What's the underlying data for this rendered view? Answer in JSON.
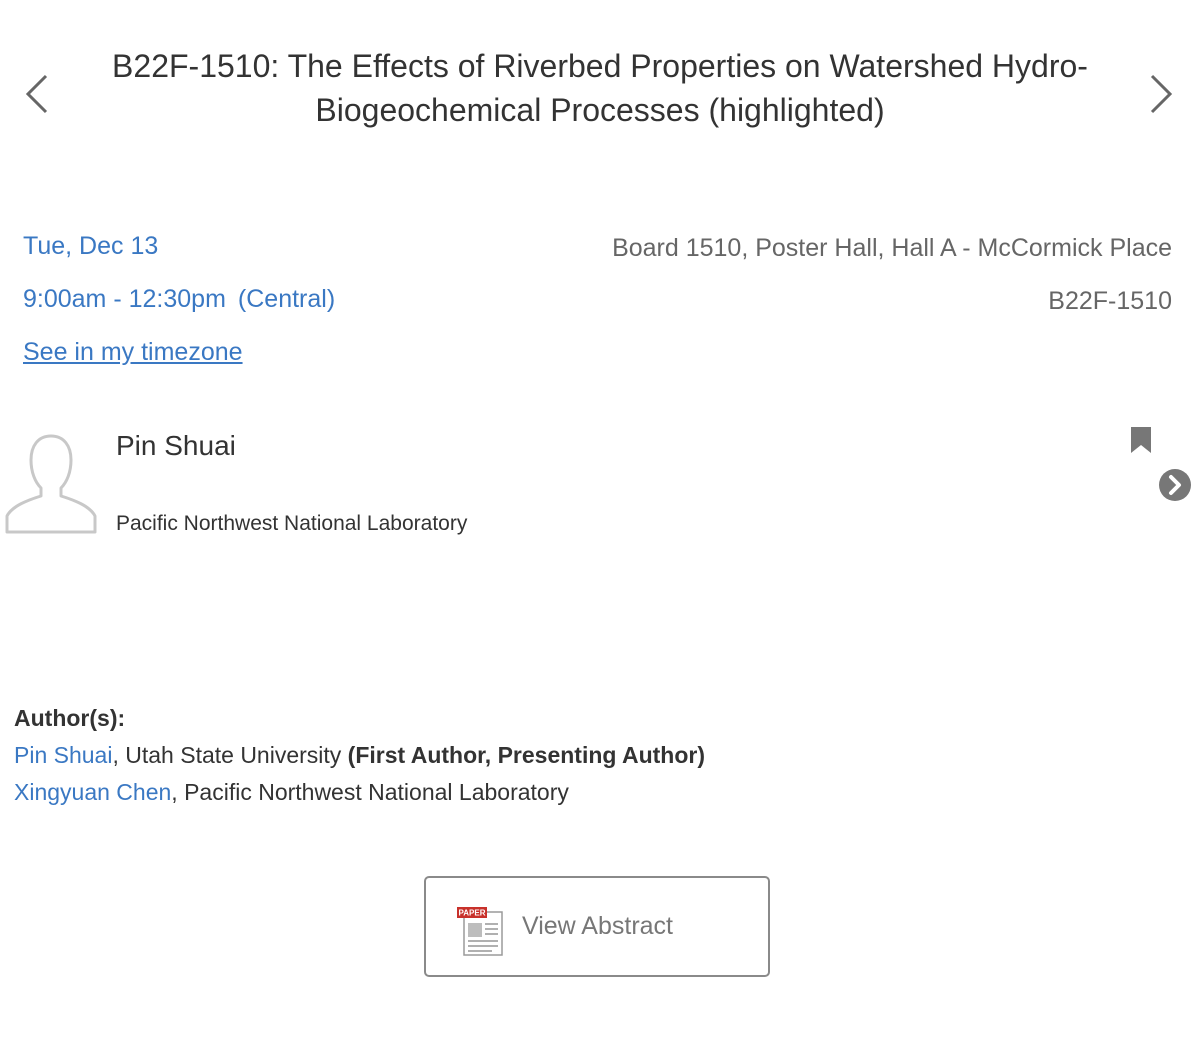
{
  "navigation": {
    "prev_icon": "chevron-left-icon",
    "next_icon": "chevron-right-icon"
  },
  "session": {
    "title": "B22F-1510: The Effects of Riverbed Properties on Watershed Hydro-Biogeochemical Processes (highlighted)",
    "date": "Tue, Dec 13",
    "time": "9:00am - 12:30pm",
    "timezone": "(Central)",
    "timezone_link": "See in my timezone",
    "location": "Board 1510, Poster Hall, Hall A - McCormick Place",
    "code": "B22F-1510"
  },
  "presenter": {
    "name": "Pin Shuai",
    "institution": "Pacific Northwest National Laboratory",
    "avatar_icon": "person-silhouette-icon",
    "bookmark_icon": "bookmark-icon",
    "more_icon": "chevron-circle-right-icon"
  },
  "authors": {
    "heading": "Author(s):",
    "list": [
      {
        "name": "Pin Shuai",
        "affiliation": ", Utah State University ",
        "role": "(First Author, Presenting Author)"
      },
      {
        "name": "Xingyuan Chen",
        "affiliation": ", Pacific Northwest National Laboratory",
        "role": ""
      }
    ]
  },
  "abstract_button": {
    "label": "View Abstract",
    "icon": "paper-document-icon",
    "icon_text": "PAPER"
  },
  "colors": {
    "link": "#3a78c3",
    "text": "#333333",
    "muted": "#666666",
    "icon_red": "#c8312b"
  }
}
